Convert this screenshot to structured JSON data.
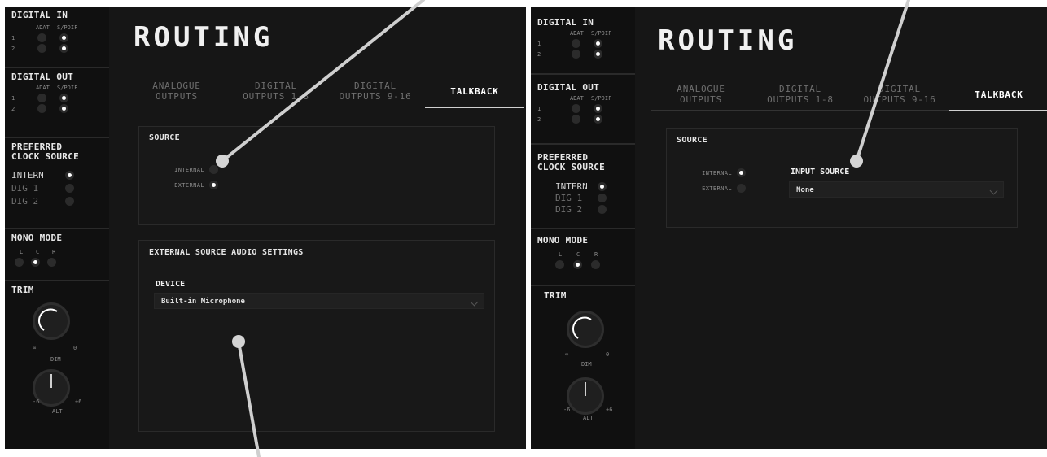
{
  "sidebar": {
    "digital_in": {
      "title": "DIGITAL IN",
      "col_a": "ADAT",
      "col_b": "S/PDIF",
      "row1": "1",
      "row2": "2"
    },
    "digital_out": {
      "title": "DIGITAL OUT",
      "col_a": "ADAT",
      "col_b": "S/PDIF",
      "row1": "1",
      "row2": "2"
    },
    "clock": {
      "title_line1": "PREFERRED",
      "title_line2": "CLOCK SOURCE",
      "options": [
        "INTERN",
        "DIG 1",
        "DIG 2"
      ]
    },
    "mono": {
      "title": "MONO MODE",
      "left": "L",
      "center": "C",
      "right": "R"
    },
    "trim": {
      "title": "TRIM",
      "min": "∞",
      "max_left": "0",
      "max_right": "0",
      "dim": "DIM",
      "alt_min": "-6",
      "alt_max": "+6",
      "alt": "ALT"
    }
  },
  "header": {
    "title": "ROUTING"
  },
  "tabs": [
    {
      "line1": "ANALOGUE",
      "line2": "OUTPUTS"
    },
    {
      "line1": "DIGITAL",
      "line2": "OUTPUTS 1-8"
    },
    {
      "line1": "DIGITAL",
      "line2": "OUTPUTS 9-16"
    },
    {
      "line1": "TALKBACK",
      "line2": ""
    }
  ],
  "left_panel": {
    "source_title": "SOURCE",
    "internal": "INTERNAL",
    "external": "EXTERNAL",
    "selected": "external",
    "ext_title": "EXTERNAL SOURCE AUDIO SETTINGS",
    "device_label": "DEVICE",
    "device_value": "Built-in Microphone"
  },
  "right_panel": {
    "source_title": "SOURCE",
    "internal": "INTERNAL",
    "external": "EXTERNAL",
    "selected": "internal",
    "input_source_label": "INPUT SOURCE",
    "input_source_value": "None"
  },
  "colors": {
    "panel_bg": "#161616",
    "sidebar_bg": "#101010",
    "text": "#d4d4d4",
    "active": "#ffffff"
  }
}
